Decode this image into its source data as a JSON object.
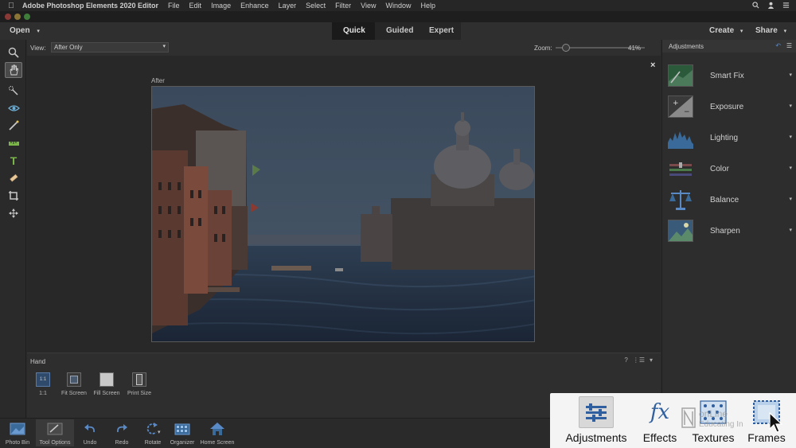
{
  "menubar": {
    "app_name": "Adobe Photoshop Elements 2020 Editor",
    "items": [
      "File",
      "Edit",
      "Image",
      "Enhance",
      "Layer",
      "Select",
      "Filter",
      "View",
      "Window",
      "Help"
    ]
  },
  "modebar": {
    "open_label": "Open",
    "tabs": [
      {
        "label": "Quick",
        "active": true
      },
      {
        "label": "Guided",
        "active": false
      },
      {
        "label": "Expert",
        "active": false
      }
    ],
    "create_label": "Create",
    "share_label": "Share"
  },
  "tools": [
    "zoom-tool",
    "hand-tool",
    "quick-selection-tool",
    "red-eye-tool",
    "whiten-teeth-tool",
    "straighten-tool",
    "type-tool",
    "spot-healing-tool",
    "crop-tool",
    "move-tool"
  ],
  "viewbar": {
    "view_label": "View:",
    "view_value": "After Only",
    "zoom_label": "Zoom:",
    "zoom_value": "41%",
    "zoom_fraction": 0.08
  },
  "canvas": {
    "after_label": "After",
    "close_label": "×"
  },
  "tool_options": {
    "title": "Hand",
    "buttons": [
      {
        "label": "1:1",
        "box_text": "1:1"
      },
      {
        "label": "Fit Screen",
        "box_text": ""
      },
      {
        "label": "Fill Screen",
        "box_text": ""
      },
      {
        "label": "Print Size",
        "box_text": ""
      }
    ]
  },
  "adjustments": {
    "header": "Adjustments",
    "items": [
      "Smart Fix",
      "Exposure",
      "Lighting",
      "Color",
      "Balance",
      "Sharpen"
    ]
  },
  "taskbar": {
    "items": [
      "Photo Bin",
      "Tool Options",
      "Undo",
      "Redo",
      "Rotate",
      "Organizer",
      "Home Screen"
    ]
  },
  "callout": {
    "items": [
      {
        "label": "Adjustments",
        "active": true
      },
      {
        "label": "Effects",
        "active": false
      },
      {
        "label": "Textures",
        "active": false
      },
      {
        "label": "Frames",
        "active": false
      }
    ],
    "effects_glyph": "fx"
  },
  "watermark": {
    "line1": "onLine",
    "line2": "Educating In"
  },
  "colors": {
    "accent_blue": "#2f5f9e",
    "callout_bg": "#f4f4f4",
    "dark_bg": "#2b2b2b"
  }
}
